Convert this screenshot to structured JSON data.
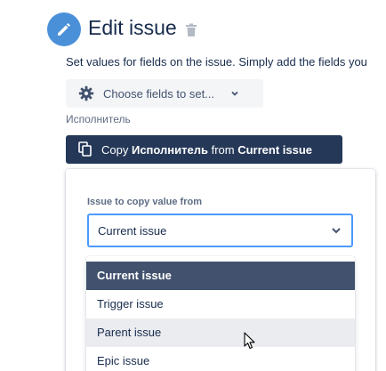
{
  "header": {
    "title": "Edit issue",
    "icon": "pencil-icon",
    "accent_color": "#4a90d9"
  },
  "description": "Set values for fields on the issue. Simply add the fields you",
  "choose_fields": {
    "label": "Choose fields to set..."
  },
  "field": {
    "label": "Исполнитель"
  },
  "copy_button": {
    "prefix": "Copy ",
    "field": "Исполнитель",
    "middle": " from ",
    "source": "Current issue"
  },
  "popup": {
    "label": "Issue to copy value from",
    "select_value": "Current issue"
  },
  "menu": {
    "options": [
      {
        "label": "Current issue",
        "state": "selected"
      },
      {
        "label": "Trigger issue",
        "state": "normal"
      },
      {
        "label": "Parent issue",
        "state": "hovered"
      },
      {
        "label": "Epic issue",
        "state": "normal"
      }
    ]
  }
}
